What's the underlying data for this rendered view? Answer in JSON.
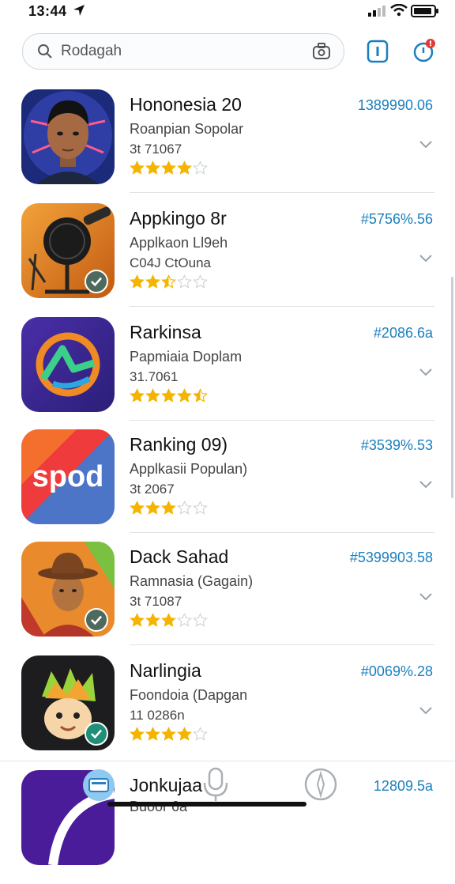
{
  "status_bar": {
    "time": "13:44"
  },
  "search": {
    "query": "Rodagah"
  },
  "colors": {
    "price": "#1a7fbf",
    "star": "#f4b400",
    "accent": "#1a7fbf"
  },
  "apps": [
    {
      "title": "Hononesia 20",
      "subtitle": "Roanpian Sopolar",
      "meta": "3t 71067",
      "price": "1389990.06",
      "rating": 4,
      "icon": "portrait-man-icon"
    },
    {
      "title": "Appkingo 8r",
      "subtitle": "Applkaon Ll9eh",
      "meta": "C04J CtOuna",
      "price": "#5756%.56",
      "rating": 2.5,
      "icon": "microphone-icon"
    },
    {
      "title": "Rarkinsa",
      "subtitle": "Papmiaia Doplam",
      "meta": "31.7061",
      "price": "#2086.6a",
      "rating": 4.5,
      "icon": "abstract-logo-icon"
    },
    {
      "title": "Ranking 09)",
      "subtitle": "Applkasii Populan)",
      "meta": "3t 2067",
      "price": "#3539%.53",
      "rating": 3,
      "icon": "sprod-logo-icon"
    },
    {
      "title": "Dack Sahad",
      "subtitle": "Ramnasia (Gagain)",
      "meta": "3t 71087",
      "price": "#5399903.58",
      "rating": 3,
      "icon": "portrait-cowboy-icon"
    },
    {
      "title": "Narlingia",
      "subtitle": "Foondoia (Dapgan",
      "meta": "11 0286n",
      "price": "#0069%.28",
      "rating": 4,
      "icon": "cartoon-face-icon"
    },
    {
      "title": "Jonkujaa",
      "subtitle": "Buoor 6a",
      "meta": "",
      "price": "12809.5a",
      "rating": 0,
      "icon": "purple-arc-icon"
    }
  ]
}
